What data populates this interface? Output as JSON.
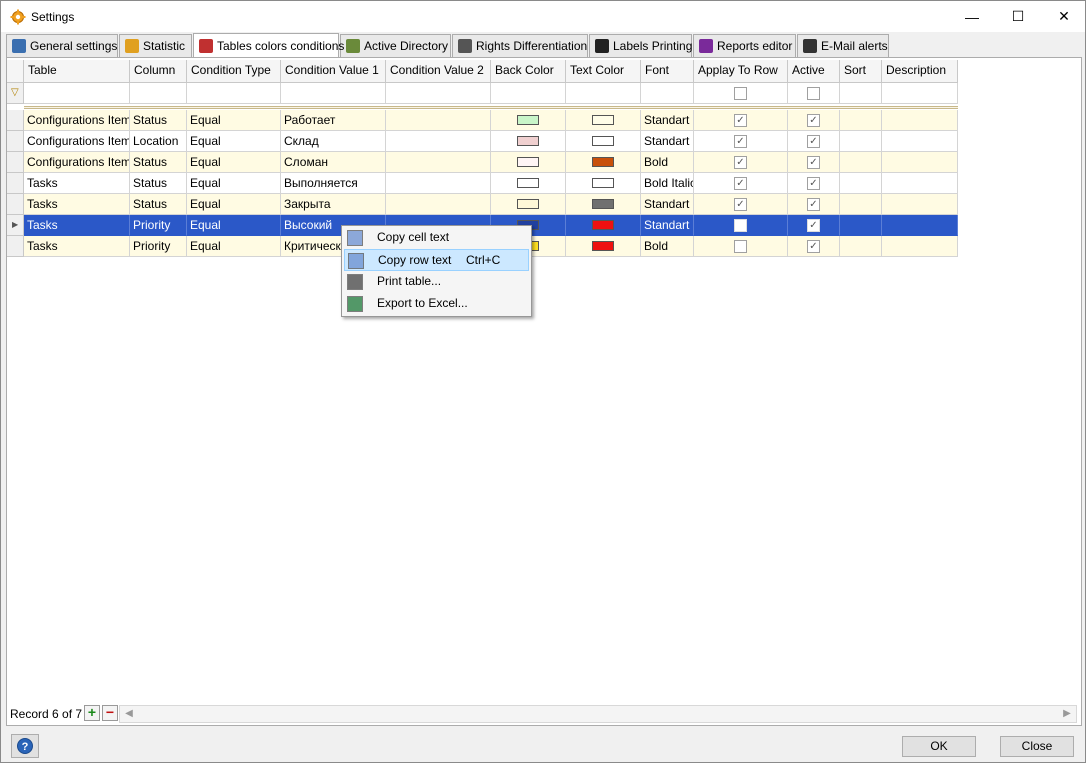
{
  "window": {
    "title": "Settings",
    "minimize": "—",
    "maximize": "☐",
    "close": "✕"
  },
  "tabs": [
    {
      "label": "General settings",
      "icon": "tools-icon",
      "color": "#3b6fb0"
    },
    {
      "label": "Statistic",
      "icon": "database-icon",
      "color": "#e0a020"
    },
    {
      "label": "Tables colors conditions",
      "icon": "color-grid-icon",
      "color": "#c03030"
    },
    {
      "label": "Active Directory",
      "icon": "books-icon",
      "color": "#6a8a3a"
    },
    {
      "label": "Rights Differentiation",
      "icon": "key-icon",
      "color": "#555555"
    },
    {
      "label": "Labels Printing",
      "icon": "barcode-icon",
      "color": "#222222"
    },
    {
      "label": "Reports editor",
      "icon": "bar-chart-icon",
      "color": "#7a2a9a"
    },
    {
      "label": "E-Mail alerts",
      "icon": "email-icon",
      "color": "#333333"
    }
  ],
  "columns": [
    "Table",
    "Column",
    "Condition Type",
    "Condition Value 1",
    "Condition Value 2",
    "Back Color",
    "Text Color",
    "Font",
    "Applay To Row",
    "Active",
    "Sort",
    "Description"
  ],
  "rows": [
    {
      "table": "Configurations Items",
      "column": "Status",
      "condition_type": "Equal",
      "value1": "Работает",
      "value2": "",
      "back_color": "#c8f5c8",
      "text_color": "#fffde8",
      "font": "Standart",
      "apply_to_row": true,
      "active": true,
      "sort": "",
      "description": ""
    },
    {
      "table": "Configurations Items",
      "column": "Location",
      "condition_type": "Equal",
      "value1": "Склад",
      "value2": "",
      "back_color": "#f0d0d0",
      "text_color": "#ffffff",
      "font": "Standart",
      "apply_to_row": true,
      "active": true,
      "sort": "",
      "description": ""
    },
    {
      "table": "Configurations Items",
      "column": "Status",
      "condition_type": "Equal",
      "value1": "Сломан",
      "value2": "",
      "back_color": "#fff5f5",
      "text_color": "#c8500a",
      "font": "Bold",
      "apply_to_row": true,
      "active": true,
      "sort": "",
      "description": ""
    },
    {
      "table": "Tasks",
      "column": "Status",
      "condition_type": "Equal",
      "value1": "Выполняется",
      "value2": "",
      "back_color": "#ffffff",
      "text_color": "#ffffff",
      "font": "Bold Italic",
      "apply_to_row": true,
      "active": true,
      "sort": "",
      "description": ""
    },
    {
      "table": "Tasks",
      "column": "Status",
      "condition_type": "Equal",
      "value1": "Закрыта",
      "value2": "",
      "back_color": "#fff8d8",
      "text_color": "#707070",
      "font": "Standart",
      "apply_to_row": true,
      "active": true,
      "sort": "",
      "description": ""
    },
    {
      "table": "Tasks",
      "column": "Priority",
      "condition_type": "Equal",
      "value1": "Высокий",
      "value2": "",
      "back_color": "#2040a0",
      "text_color": "#ee1010",
      "font": "Standart",
      "apply_to_row": false,
      "active": true,
      "sort": "",
      "description": ""
    },
    {
      "table": "Tasks",
      "column": "Priority",
      "condition_type": "Equal",
      "value1": "Критический",
      "value2": "",
      "back_color": "#ffe020",
      "text_color": "#ee1010",
      "font": "Bold",
      "apply_to_row": false,
      "active": true,
      "sort": "",
      "description": ""
    }
  ],
  "selected_row_index": 5,
  "context_menu": {
    "items": [
      {
        "label": "Copy cell text",
        "shortcut": "",
        "icon": "copy-icon"
      },
      {
        "label": "Copy row text",
        "shortcut": "Ctrl+C",
        "icon": "copy-row-icon"
      },
      {
        "label": "Print table...",
        "shortcut": "",
        "icon": "printer-icon"
      },
      {
        "label": "Export to Excel...",
        "shortcut": "",
        "icon": "excel-icon"
      }
    ],
    "highlighted_index": 1
  },
  "status_bar": {
    "record_text": "Record 6 of 7",
    "add_label": "+",
    "remove_label": "−"
  },
  "footer": {
    "help_label": "?",
    "ok_label": "OK",
    "close_label": "Close"
  },
  "colors": {
    "selection": "#2b58c8",
    "alt_row": "#fffbe3",
    "menu_highlight": "#cce8ff"
  }
}
